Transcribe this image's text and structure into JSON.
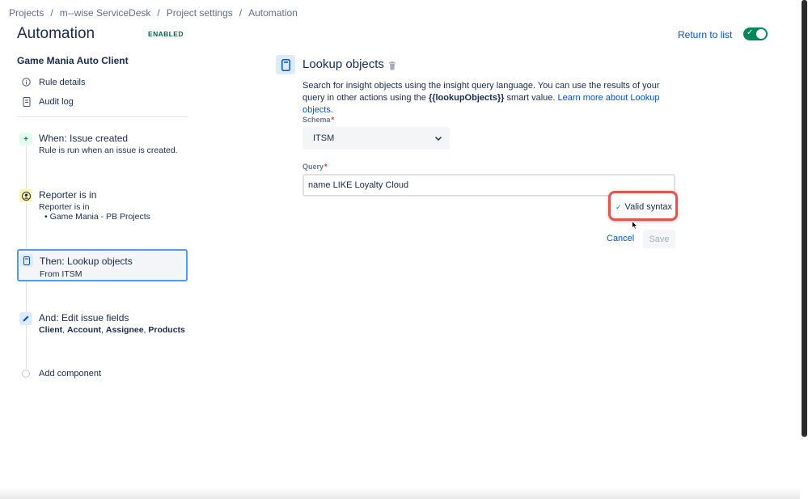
{
  "breadcrumb": [
    "Projects",
    "m--wise ServiceDesk",
    "Project settings",
    "Automation"
  ],
  "breadcrumb_separator": "/",
  "header": {
    "title": "Automation",
    "status_lozenge": "ENABLED",
    "return_link": "Return to list",
    "toggle_on": true
  },
  "sidebar": {
    "rule_name": "Game Mania Auto Client",
    "links": [
      {
        "label": "Rule details",
        "icon": "info-icon"
      },
      {
        "label": "Audit log",
        "icon": "document-icon"
      }
    ],
    "steps": [
      {
        "title": "When: Issue created",
        "sub": "Rule is run when an issue is created.",
        "icon": "plus-icon"
      },
      {
        "title": "Reporter is in",
        "sub": "Reporter is in",
        "list_item": "Game Mania - PB Projects",
        "icon": "user-condition-icon"
      },
      {
        "title": "Then: Lookup objects",
        "sub": "From ITSM",
        "icon": "lookup-object-icon"
      },
      {
        "title": "And: Edit issue fields",
        "fields": [
          "Client",
          "Account",
          "Assignee",
          "Products"
        ],
        "icon": "pencil-icon"
      }
    ],
    "add_component": "Add component"
  },
  "panel": {
    "title": "Lookup objects",
    "description_part1": "Search for insight objects using the insight query language. You can use the results of your query in other actions using the ",
    "smart_value": "{{lookupObjects}}",
    "description_part2": " smart value. ",
    "learn_more": "Learn more about Lookup objects",
    "description_end": ".",
    "schema_label": "Schema",
    "schema_value": "ITSM",
    "query_label": "Query",
    "query_value": "name LIKE Loyalty Cloud",
    "required_mark": "*",
    "valid_syntax": "Valid syntax",
    "cancel_label": "Cancel",
    "save_label": "Save"
  },
  "colors": {
    "link": "#0052cc",
    "toggle": "#00875a",
    "highlight_outline": "#e5534b",
    "selected_border": "#4c9aff"
  }
}
